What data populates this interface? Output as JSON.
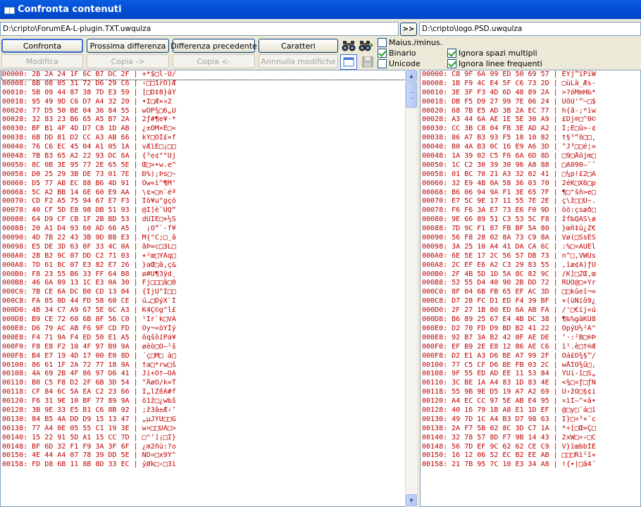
{
  "window": {
    "title": "Confronta contenuti"
  },
  "paths": {
    "left": "D:\\cripto\\ForumEA-L-plugin.TXT.uwqulza",
    "right": "D:\\cripto\\logo.PSD.uwqulza",
    "swap_label": ">>"
  },
  "toolbar": {
    "confronta": "Confronta",
    "prossima": "Prossima differenza",
    "precedente": "Differenza precedente",
    "caratteri": "Caratteri",
    "modifica": "Modifica",
    "copia_right": "Copia ->",
    "copia_left": "Copia <-",
    "annulla": "Annnulla modifiche"
  },
  "options": {
    "maius": {
      "label": "Maius./minus.",
      "checked": false
    },
    "binario": {
      "label": "Binario",
      "checked": true
    },
    "unicode": {
      "label": "Unicode",
      "checked": false
    },
    "ignora_spazi": {
      "label": "Ignora spazi multipli",
      "checked": true
    },
    "ignora_linee": {
      "label": "Ignora linee frequenti",
      "checked": true
    }
  },
  "icons": {
    "find": "binoculars-icon",
    "find_next": "binoculars-next-icon",
    "view": "window-icon",
    "save": "floppy-icon"
  },
  "colors": {
    "hex_text": "#c00000",
    "title_bar": "#0350d8"
  },
  "left_rows": [
    "00000: 2B 2A 24 1F 6C B7 DC 2F | +*$□l·Ü/",
    "00008: 8B 08 05 31 72 D6 29 C6 | ‹□□1rÖ)Æ",
    "00010: 5B 09 44 87 38 7D E3 59 | [□D‡8}ãY",
    "00018: 95 49 9D C6 D7 A4 32 20 | •I□Æ×¤2 ",
    "00020: 77 D5 50 BE 04 36 84 55 | wÕP¾□6„U",
    "00028: 32 83 23 B6 65 A5 B7 2A | 2ƒ#¶e¥·*",
    "00030: BF B1 4F 4D D7 C8 1D AB | ¿±OM×È□«",
    "00038: 6B DD 81 D2 CC A3 AB 66 | kÝ□ÒÌ£«f",
    "00040: 76 C6 EC 45 04 A1 05 1A | vÆìE□¡□□",
    "00048: 7B B3 65 A2 22 93 DC 6A | {³e¢\"\"Üj",
    "00050: 8C 0B 3E 95 77 2E 65 5E | Œ□>•w.e^",
    "00058: D0 25 29 3B DE 73 01 7E | Ð%);Þs□~",
    "00060: D5 77 AB EC 88 B6 4D 91 | Õw«ì^¶M‘",
    "00068: 5C A2 BB 14 6E 60 E9 AA | \\¢»□n`éª",
    "00070: CD F2 A5 75 94 67 E7 F3 | Íò¥u\"gçó",
    "00078: 40 CF 5D E8 98 DB 51 93 | @Ï]è˜ÛQ“",
    "00080: 64 D9 CF CB 1F 2B BD 53 | dÙÏË□+½S",
    "00088: 20 A1 D4 93 60 AD 66 A5 |  ¡Ô“`-f¥",
    "00090: 4D 7B 22 43 3B 9D B8 E3 | M{\"C;□¸ã",
    "00098: E5 DE 3D 63 0F 33 4C 0A | åÞ=c□3L□",
    "000A0: 2B B2 9C 07 DD C2 71 03 | +²œ□ÝÂq□",
    "000A8: 7D 61 8C 07 E3 82 E7 26 | }aŒ□ã‚ç&",
    "000B0: F8 23 55 B6 33 FF 64 B8 | ø#U¶3ÿd¸",
    "000B8: 46 6A 09 13 1C E3 0A 30 | Fj□□□ã□0",
    "000C0: 7B CE 6A DC B0 CD 13 04 | {ÎjÜ°Í□□",
    "000C8: FA 85 0D 44 FD 58 60 CE | ú…□DýX`Î",
    "000D0: 4B 34 C7 A9 67 5E 6C A3 | K4Ç©g^l£",
    "000D8: B9 CE 72 60 6B 8F 56 C0 | ¹Îr`k□VÀ",
    "000E0: D6 79 AC AB F6 9F CD FD | Öy¬«öŸÍý",
    "000E8: F4 71 9A F4 ED 50 E1 A5 | ôqšôíPá¥",
    "000F0: F8 E8 F2 10 4F 97 B9 9A | øèò□O—¹š",
    "000F8: B4 E7 19 4D 17 00 E0 8D | ´ç□M□ à□",
    "00100: 86 61 1F 2A 72 77 18 9A | †a□*rw□š",
    "00108: 4A 69 2B 4F 86 97 D6 41 | Ji+O†—ÖA",
    "00110: B0 C5 F8 D2 2F 6B 3D 54 | °ÅøÒ/k=T",
    "00118: CF 84 6C 5A EA C2 23 66 | Ï„lZêÂ#f",
    "00120: F6 31 9E 10 BF 77 89 9A | ö1ž□¿w‰š",
    "00128: 3B 9E 33 E5 B1 C6 8B 92 | ;ž3å±Æ‹’",
    "00130: 84 B5 4A DD D9 15 13 47 | „µJÝÙ□□G",
    "00138: 77 A4 0E 05 55 C1 19 3E | w¤□□UÁ□>",
    "00140: 15 22 91 5D A1 15 CC 7D | □\"‘]¡□Ì}",
    "00148: BF 6D 32 F1 F9 3A 3F 6F | ¿m2ñù:?o",
    "00150: 4E 44 A4 07 78 39 DD 5E | ND¤□x9Ý^",
    "00158: FD D8 6B 11 8B 8D 33 EC | ýØk□‹□3ì"
  ],
  "right_rows": [
    "00000: C8 9F 6A 99 ED 50 69 57 | ÈŸj™íPiW",
    "00008: 1B F9 4C E4 5F C6 73 2D | □ùLä_Æs-",
    "00010: 3E 3F F3 4D 6D 48 89 2A | >?óMmH‰*",
    "00018: DB F5 D9 27 99 7E 06 24 | ÛõÙ'™~□$",
    "00020: 68 7B E5 AD 3B 2A EC 77 | h{å-;*ìw",
    "00028: A3 44 6A AE 1E 5E 30 A9 | £Dj®□^0©",
    "00030: CC 3B C8 04 FB 3E AD A2 | Ì;È□û>-¢",
    "00038: 86 A7 B3 93 F5 18 10 82 | †§³“õ□□‚",
    "00040: B0 4A B3 0C 16 E9 A6 3D | °J³□□é¦=",
    "00048: 1A 39 02 C5 F6 6A 6D 8D | □9□Åöjm□",
    "00050: 1C C2 30 39 30 96 A8 88 | □Â090–¨ˆ",
    "00058: 01 BC 70 21 A3 32 02 41 | □¼p!£2□A",
    "00060: 32 E9 4B 0A 58 36 03 70 | 2éK□X6□p",
    "00068: B6 06 94 9A F1 3E 65 7F | ¶□\"šñ>e□",
    "00070: E7 5C 9E 17 11 55 7E 2E | ç\\ž□□U~.",
    "00078: F6 F6 3A E7 73 E6 F0 9D | öö:çsæð□",
    "00080: 9E 66 89 51 C3 53 5C F8 | žf‰QÃS\\ø",
    "00088: 7D 9C F1 87 FB BF 5A 80 | }œñ‡û¿Z€",
    "00090: 56 F8 28 02 8A 73 C9 8A | Vø(□ŠsÉŠ",
    "00098: 3A 25 10 A4 41 DA CA 6C | :%□¤AÚÊl",
    "000A0: 6E 5E 17 2C 56 57 DB 73 | n^□,VWÛs",
    "000A8: 2C EF E6 A2 C3 29 83 55 | ,ïæ¢Ã)ƒU",
    "000B0: 2F 4B 5D 1D 5A 8C 82 9C | /K]□ZŒ‚œ",
    "000B8: 52 55 D4 40 90 2B DD 72 | RUÔ@□+Ýr",
    "000C0: 8F 04 6B FB 65 EF AC 3D | □□kûeï¬=",
    "000C8: D7 28 FC D1 ED F4 39 BF | ×(üÑíô9¿",
    "000D0: 2F 27 1B 80 ED 6A AB FA | /'□€íj«ú",
    "000D8: B6 89 25 67 E4 4B DC 38 | ¶‰%gäKÜ8",
    "000E0: D2 70 FD D9 BD B2 41 22 | ÒpýÙ½²A\"",
    "000E8: 92 B7 3A B2 42 0F AE DE | ’·:²B□®Þ",
    "000F0: EF B9 2E E8 12 86 AE C6 | ï¹.è□†®Æ",
    "000F8: D2 E1 A3 D6 BE A7 99 2F | Òá£Ö¾§™/",
    "00100: 77 C5 CF D6 BE FB 03 2C | wÅÏÖ¾û□,",
    "00108: 9F 55 ED AD EE 11 53 84 | ŸUí-î□S„",
    "00110: 3C BE 1A A4 83 1D 83 4E | <¾□¤ƒ□ƒN",
    "00118: 55 9B 9E D5 19 A7 A2 69 | U›žÕ□§¢i",
    "00120: A4 EC CC 97 5E AB E4 95 | ¤ìÌ—^«ä•",
    "00128: 40 16 79 1B A8 E1 1D EF | @□y□¨á□ï",
    "00130: 49 7D 1C A4 B3 D7 98 63 | I}□¤³×˜c",
    "00138: 2A F7 5B 02 8C 3D C7 1A | *÷[□Œ=Ç□",
    "00140: 32 78 57 8D F7 9B 14 43 | 2xW□÷›□C",
    "00148: 56 7D EF 9C 62 62 CE C9 | V}ïœbbÎÉ",
    "00150: 16 12 06 52 EC B2 EE AB | □□□Rì²î«",
    "00158: 21 7B 95 7C 10 E3 34 A8 | !{•|□ã4¨"
  ]
}
